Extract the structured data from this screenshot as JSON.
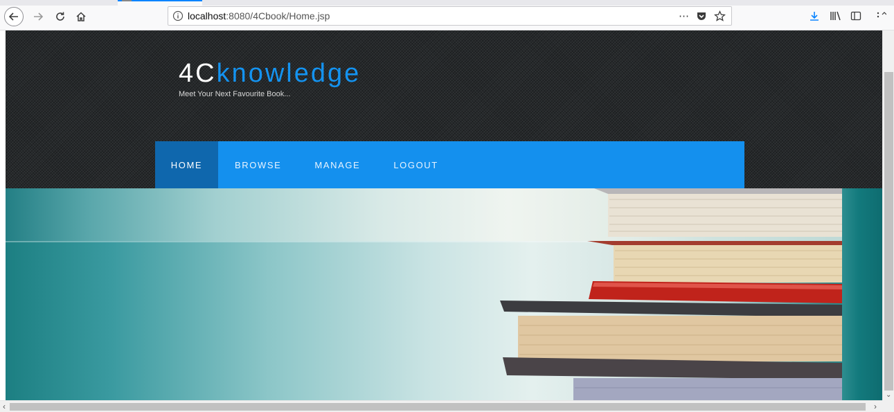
{
  "browser": {
    "url_host": "localhost",
    "url_path": ":8080/4Cbook/Home.jsp",
    "page_actions_label": "⋯",
    "icons": [
      "back-icon",
      "forward-icon",
      "reload-icon",
      "home-icon",
      "info-icon",
      "pocket-icon",
      "bookmark-star-icon",
      "download-icon",
      "library-icon",
      "sidebar-icon",
      "overflow-menu-icon"
    ]
  },
  "site": {
    "logo_prefix": "4C",
    "logo_accent": "knowledge",
    "tagline": "Meet Your Next Favourite Book...",
    "accent_color": "#1493f0",
    "nav_color": "#1490ee",
    "nav_active_color": "#0f67ad"
  },
  "nav": {
    "items": [
      {
        "label": "HOME",
        "active": true
      },
      {
        "label": "BROWSE",
        "active": false
      },
      {
        "label": "MANAGE",
        "active": false
      },
      {
        "label": "LOGOUT",
        "active": false
      }
    ]
  },
  "hero": {
    "image": "stack-of-books"
  }
}
